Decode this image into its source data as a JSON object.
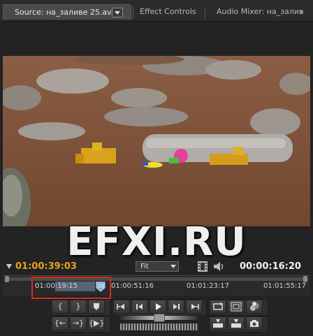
{
  "tabs": [
    {
      "label": "Source: на_заливе 25.avi",
      "active": true
    },
    {
      "label": "Effect Controls",
      "active": false
    },
    {
      "label": "Audio Mixer: на_залив",
      "active": false
    }
  ],
  "panel_menu_icon": "double-chevron-right",
  "watermark": "EFXI.RU",
  "timecode_current": "01:00:39:03",
  "timecode_duration": "00:00:16:20",
  "zoom": {
    "selected": "Fit"
  },
  "ruler": {
    "labels": [
      "01:00:19:15",
      "01:00:51:16",
      "01:01:23:17",
      "01:01:55:17"
    ]
  },
  "colors": {
    "timecode_current": "#e8a21d",
    "highlight": "#d8291f",
    "panel_bg": "#232323"
  },
  "icons": {
    "film": "film-strip-icon",
    "speaker": "speaker-icon",
    "cti": "current-time-indicator-icon"
  }
}
